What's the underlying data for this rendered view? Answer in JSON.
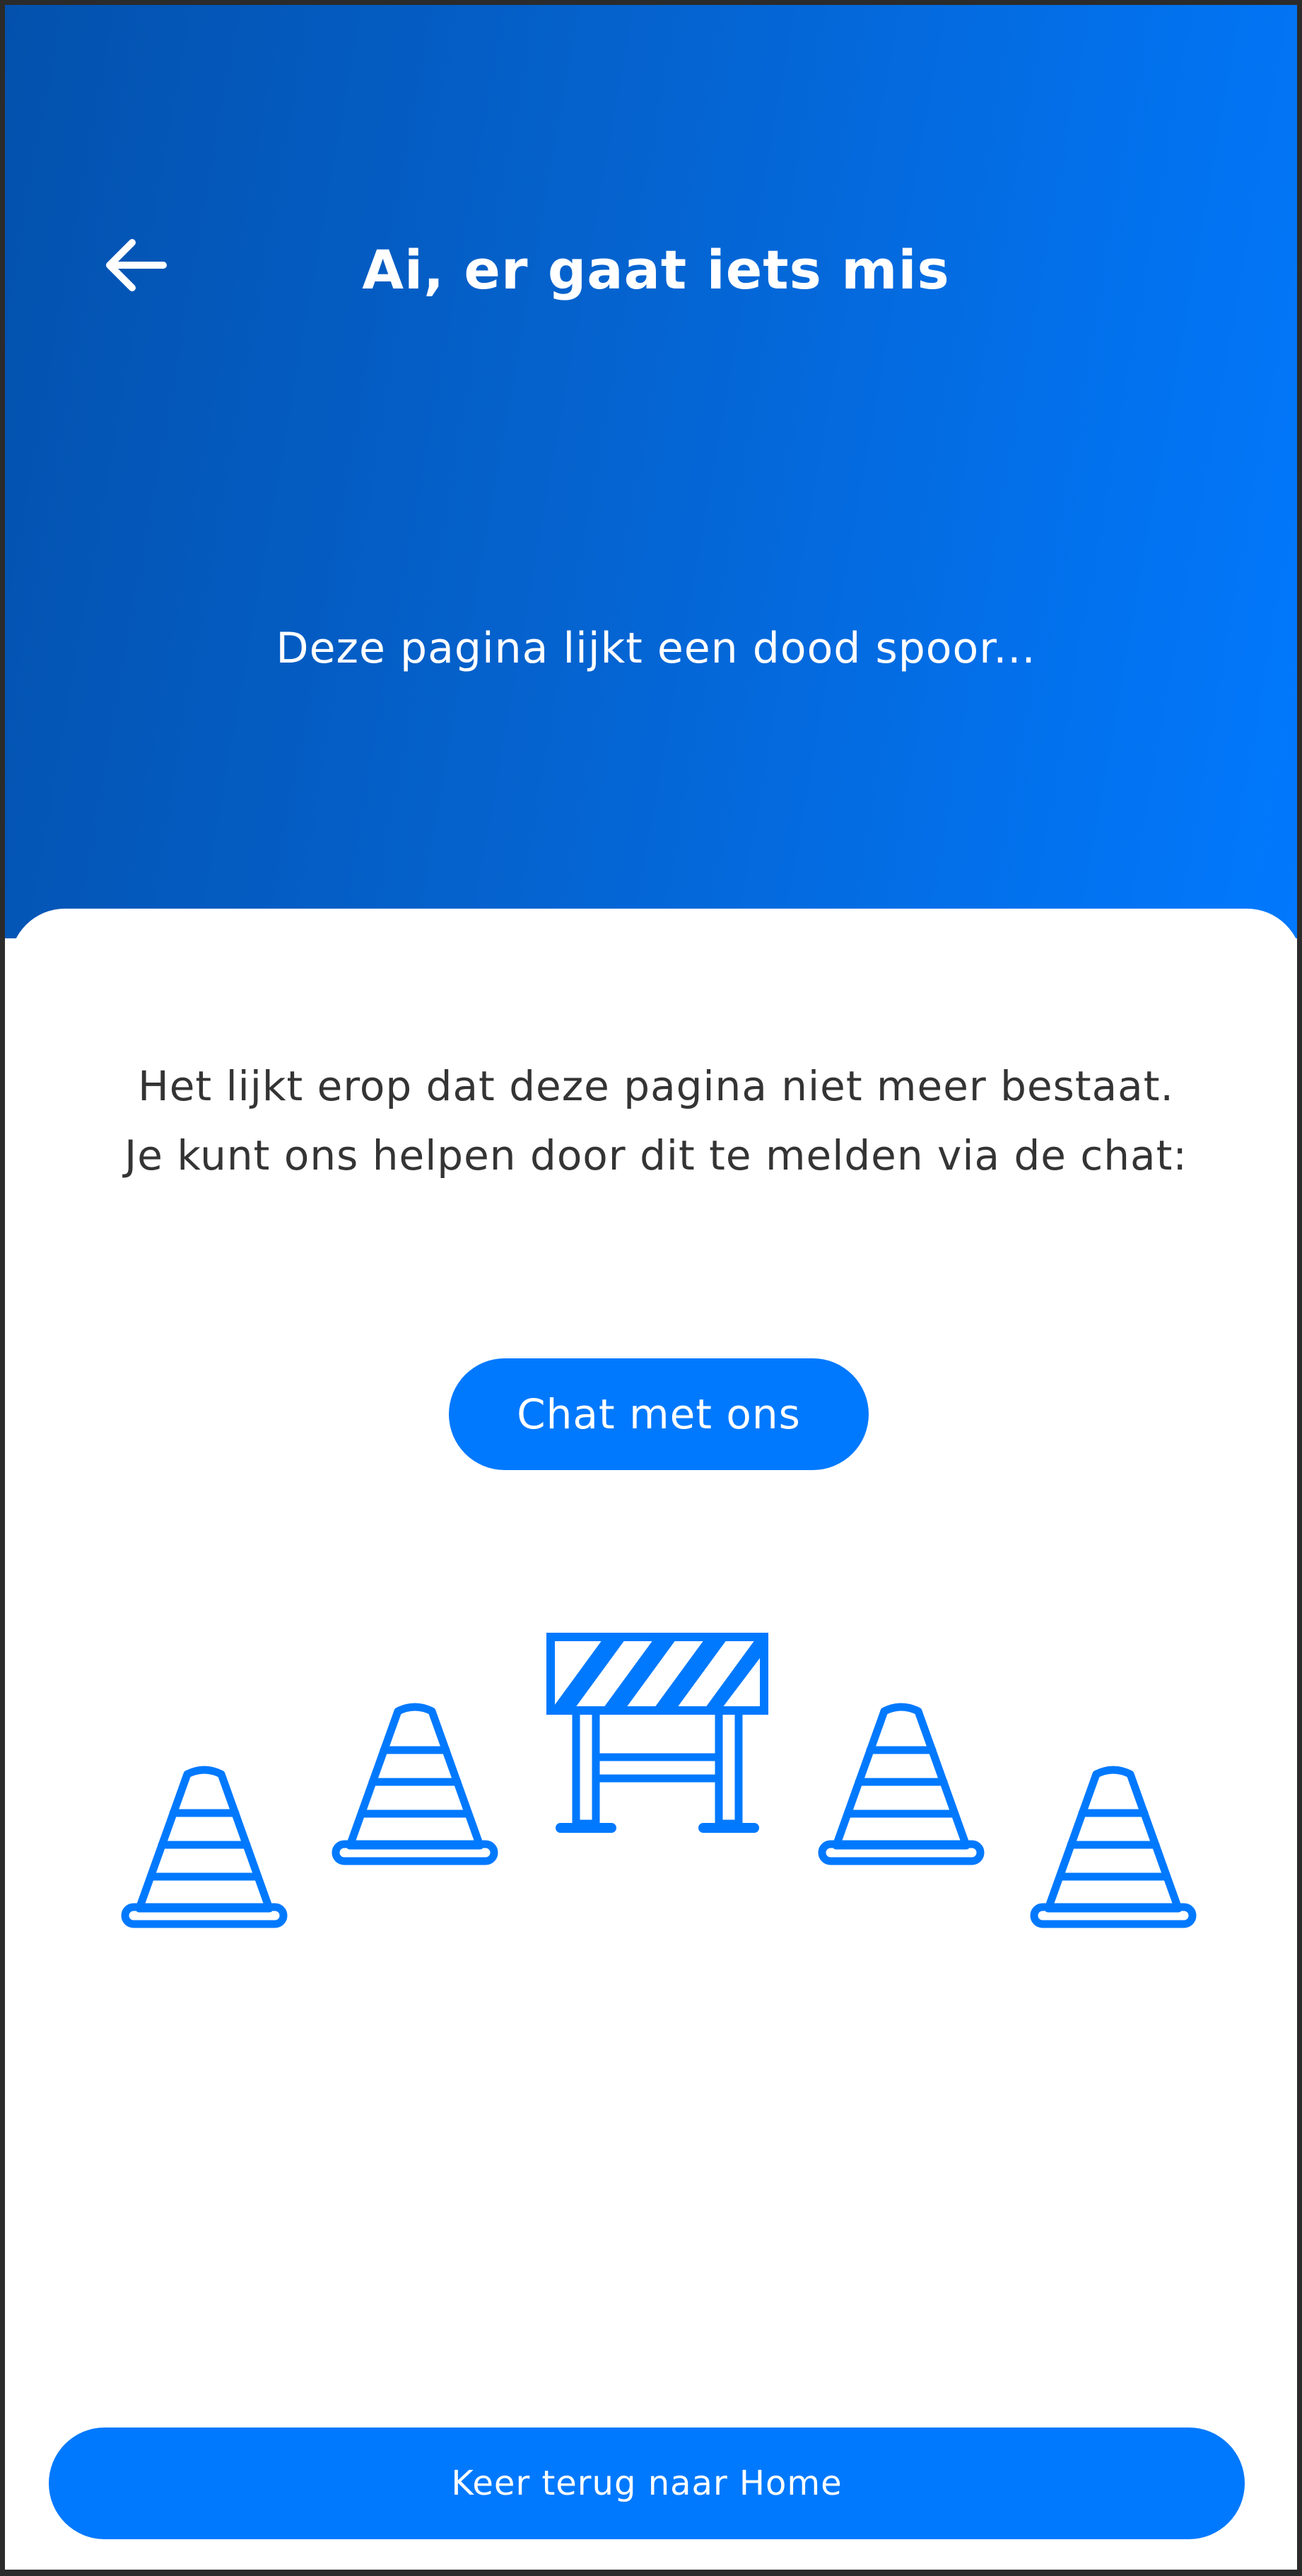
{
  "header": {
    "back_icon": "arrow-left-icon",
    "title": "Ai, er gaat iets mis",
    "subtitle": "Deze pagina lijkt een dood spoor..."
  },
  "content": {
    "message_line_1": "Het lijkt erop dat deze pagina niet meer bestaat.",
    "message_line_2": "Je kunt ons helpen door dit te melden via de chat:",
    "chat_button_label": "Chat met ons",
    "illustration_icons": [
      "traffic-cone-icon",
      "traffic-cone-icon",
      "road-barrier-icon",
      "traffic-cone-icon",
      "traffic-cone-icon"
    ]
  },
  "footer": {
    "home_button_label": "Keer terug naar Home"
  },
  "colors": {
    "accent": "#0179fe",
    "header_gradient_start": "#0351ad",
    "header_gradient_end": "#0179fe",
    "body_text": "#343434",
    "background": "#ffffff"
  }
}
